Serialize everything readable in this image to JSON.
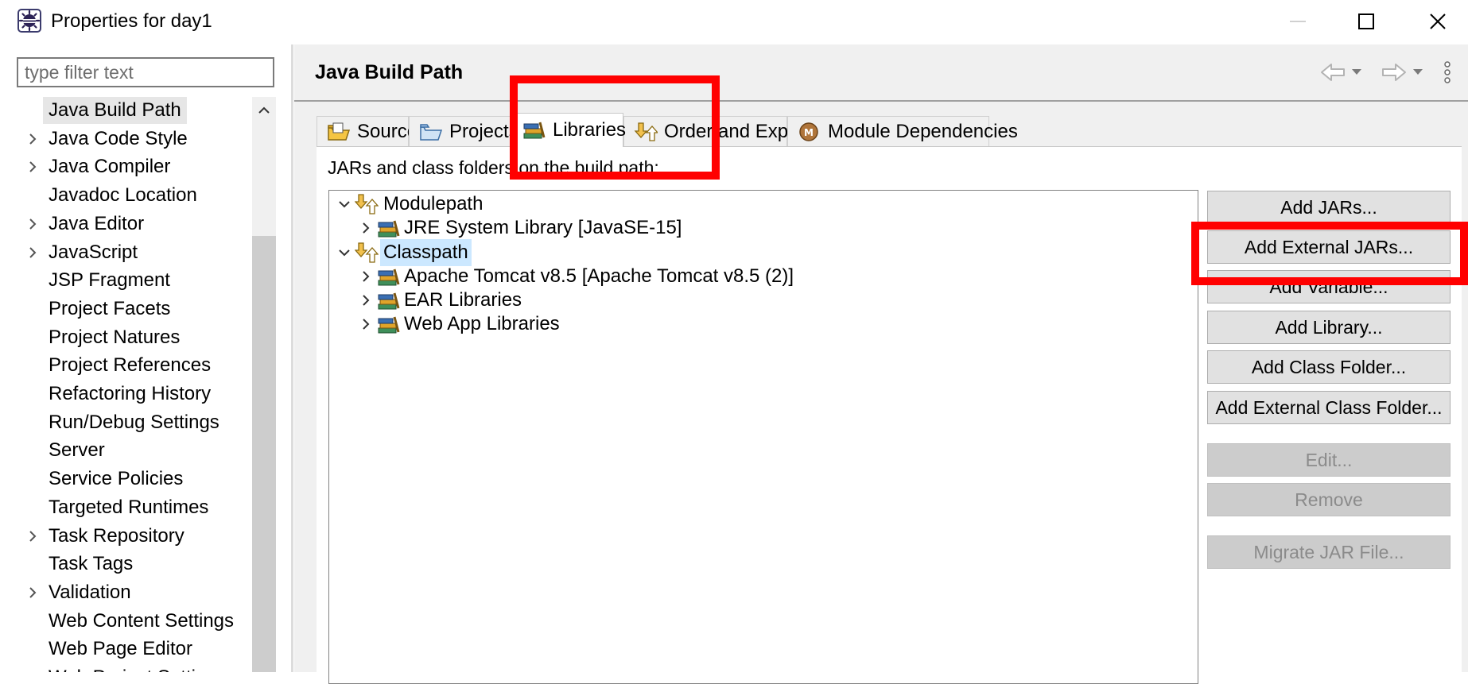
{
  "window": {
    "title": "Properties for day1",
    "controls": {
      "minimize": "minimize-icon",
      "maximize": "maximize-icon",
      "close": "close-icon"
    }
  },
  "filter": {
    "placeholder": "type filter text",
    "value": ""
  },
  "nav": {
    "items": [
      {
        "label": "Java Build Path",
        "expandable": false,
        "selected": true
      },
      {
        "label": "Java Code Style",
        "expandable": true
      },
      {
        "label": "Java Compiler",
        "expandable": true
      },
      {
        "label": "Javadoc Location",
        "expandable": false
      },
      {
        "label": "Java Editor",
        "expandable": true
      },
      {
        "label": "JavaScript",
        "expandable": true
      },
      {
        "label": "JSP Fragment",
        "expandable": false
      },
      {
        "label": "Project Facets",
        "expandable": false
      },
      {
        "label": "Project Natures",
        "expandable": false
      },
      {
        "label": "Project References",
        "expandable": false
      },
      {
        "label": "Refactoring History",
        "expandable": false
      },
      {
        "label": "Run/Debug Settings",
        "expandable": false
      },
      {
        "label": "Server",
        "expandable": false
      },
      {
        "label": "Service Policies",
        "expandable": false
      },
      {
        "label": "Targeted Runtimes",
        "expandable": false
      },
      {
        "label": "Task Repository",
        "expandable": true
      },
      {
        "label": "Task Tags",
        "expandable": false
      },
      {
        "label": "Validation",
        "expandable": true
      },
      {
        "label": "Web Content Settings",
        "expandable": false
      },
      {
        "label": "Web Page Editor",
        "expandable": false
      },
      {
        "label": "Web Project Settings",
        "expandable": false
      }
    ]
  },
  "page": {
    "title": "Java Build Path",
    "tabs": [
      {
        "label": "Source",
        "icon": "source-folder-icon"
      },
      {
        "label": "Projects",
        "icon": "projects-folder-icon"
      },
      {
        "label": "Libraries",
        "icon": "libraries-icon",
        "active": true
      },
      {
        "label": "Order and Export",
        "icon": "order-export-icon"
      },
      {
        "label": "Module Dependencies",
        "icon": "module-icon"
      }
    ],
    "caption": "JARs and class folders on the build path:",
    "tree": [
      {
        "label": "Modulepath",
        "level": 0,
        "expanded": true,
        "icon": "modulepath-icon"
      },
      {
        "label": "JRE System Library [JavaSE-15]",
        "level": 1,
        "expanded": false,
        "icon": "library-icon"
      },
      {
        "label": "Classpath",
        "level": 0,
        "expanded": true,
        "icon": "classpath-icon",
        "selected": true
      },
      {
        "label": "Apache Tomcat v8.5 [Apache Tomcat v8.5 (2)]",
        "level": 1,
        "expanded": false,
        "icon": "library-icon"
      },
      {
        "label": "EAR Libraries",
        "level": 1,
        "expanded": false,
        "icon": "library-icon"
      },
      {
        "label": "Web App Libraries",
        "level": 1,
        "expanded": false,
        "icon": "library-icon"
      }
    ],
    "buttons": [
      {
        "label": "Add JARs...",
        "enabled": true
      },
      {
        "label": "Add External JARs...",
        "enabled": true
      },
      {
        "label": "Add Variable...",
        "enabled": true
      },
      {
        "label": "Add Library...",
        "enabled": true
      },
      {
        "label": "Add Class Folder...",
        "enabled": true
      },
      {
        "label": "Add External Class Folder...",
        "enabled": true
      },
      {
        "label": "Edit...",
        "enabled": false
      },
      {
        "label": "Remove",
        "enabled": false
      },
      {
        "label": "Migrate JAR File...",
        "enabled": false
      }
    ]
  },
  "colors": {
    "highlight": "#ff0000",
    "selection": "#cce8ff",
    "panel": "#f0f0f0"
  }
}
